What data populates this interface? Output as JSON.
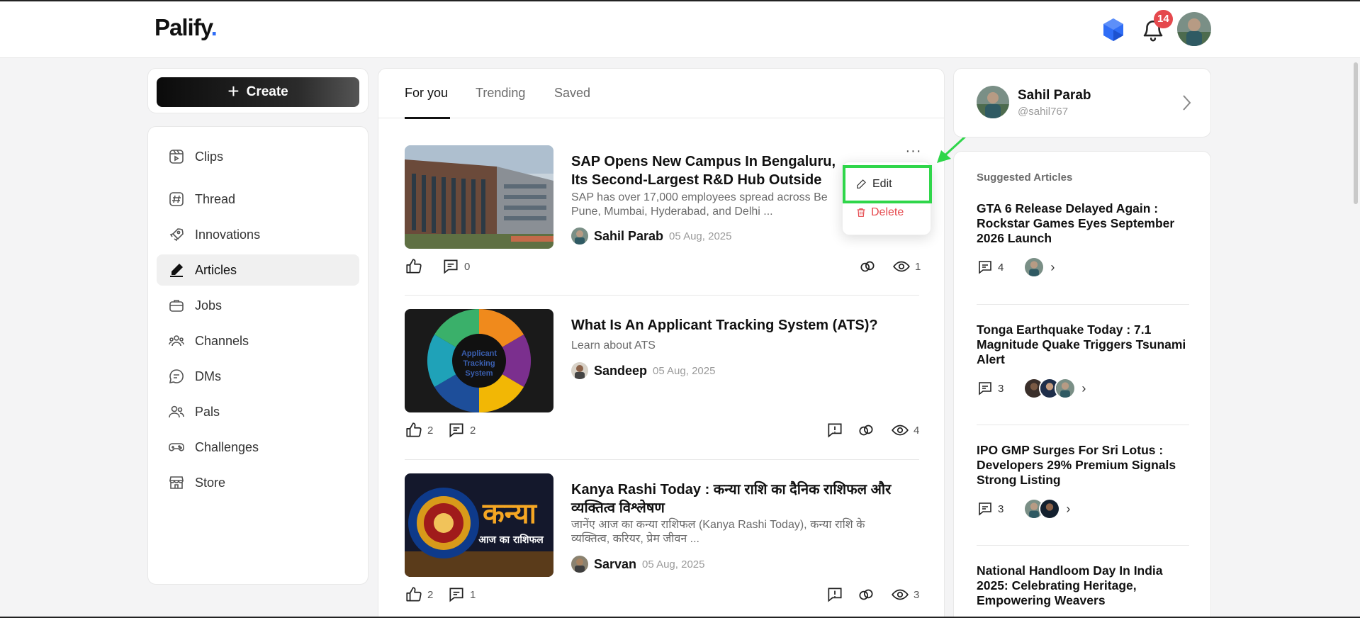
{
  "header": {
    "logo_text": "Palify",
    "logo_dot": ".",
    "notification_count": "14"
  },
  "sidebar": {
    "create_label": "Create",
    "items": [
      {
        "label": "Clips",
        "icon": "clips-icon"
      },
      {
        "label": "Thread",
        "icon": "hash-icon"
      },
      {
        "label": "Innovations",
        "icon": "rocket-icon"
      },
      {
        "label": "Articles",
        "icon": "pen-icon",
        "active": true
      },
      {
        "label": "Jobs",
        "icon": "briefcase-icon"
      },
      {
        "label": "Channels",
        "icon": "users-icon"
      },
      {
        "label": "DMs",
        "icon": "chat-icon"
      },
      {
        "label": "Pals",
        "icon": "pals-icon"
      },
      {
        "label": "Challenges",
        "icon": "gamepad-icon"
      },
      {
        "label": "Store",
        "icon": "store-icon"
      }
    ]
  },
  "feed": {
    "tabs": [
      "For you",
      "Trending",
      "Saved"
    ],
    "active_tab": "For you",
    "posts": [
      {
        "title": "SAP Opens New Campus In Bengaluru, Its Second-Largest R&D Hub Outside Germ",
        "excerpt": "SAP has over 17,000 employees spread across Be Pune, Mumbai, Hyderabad, and Delhi ...",
        "author": "Sahil Parab",
        "date": "05 Aug, 2025",
        "likes": "",
        "comments": "0",
        "views": "1"
      },
      {
        "title": "What Is An Applicant Tracking System (ATS)?",
        "excerpt": "Learn about ATS",
        "author": "Sandeep",
        "date": "05 Aug, 2025",
        "likes": "2",
        "comments": "2",
        "views": "4",
        "thumb_text": "Applicant Tracking System"
      },
      {
        "title": "Kanya Rashi Today : कन्या राशि का दैनिक राशिफल और व्यक्तित्व विश्लेषण",
        "excerpt": "जानेंए आज का कन्या राशिफल (Kanya Rashi Today), कन्या राशि के व्यक्तित्व, करियर, प्रेम जीवन ...",
        "author": "Sarvan",
        "date": "05 Aug, 2025",
        "likes": "2",
        "comments": "1",
        "views": "3",
        "thumb_text": "कन्या",
        "thumb_subtext": "आज का राशिफल"
      }
    ],
    "menu": {
      "edit_label": "Edit",
      "delete_label": "Delete"
    }
  },
  "profile": {
    "name": "Sahil Parab",
    "handle": "@sahil767"
  },
  "suggested": {
    "heading": "Suggested Articles",
    "articles": [
      {
        "title": "GTA 6 Release Delayed Again : Rockstar Games Eyes September 2026 Launch",
        "comments": "4"
      },
      {
        "title": "Tonga Earthquake Today : 7.1 Magnitude Quake Triggers Tsunami Alert",
        "comments": "3"
      },
      {
        "title": "IPO GMP Surges For Sri Lotus : Developers 29% Premium Signals Strong Listing",
        "comments": "3"
      },
      {
        "title": "National Handloom Day In India 2025: Celebrating Heritage, Empowering Weavers",
        "comments": ""
      }
    ]
  },
  "colors": {
    "accent_blue": "#2f6df6",
    "badge_red": "#e5484d",
    "highlight_green": "#2fd64a",
    "delete_red": "#e5484d"
  }
}
